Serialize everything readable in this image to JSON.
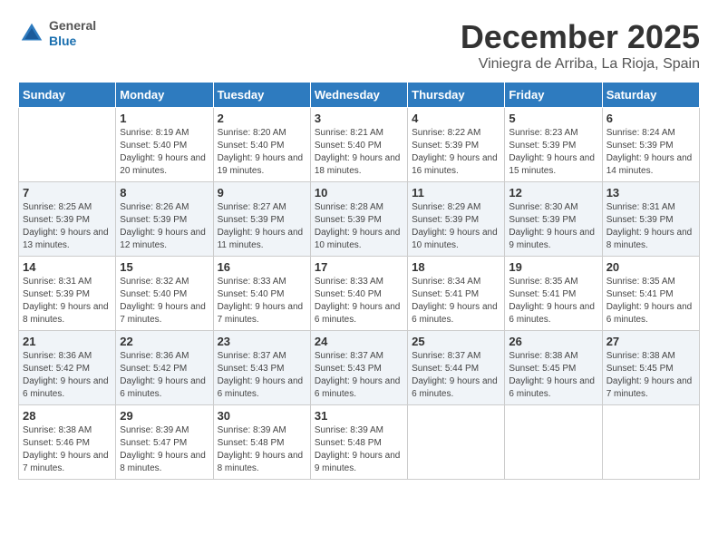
{
  "header": {
    "logo_general": "General",
    "logo_blue": "Blue",
    "month_title": "December 2025",
    "location": "Viniegra de Arriba, La Rioja, Spain"
  },
  "calendar": {
    "days_of_week": [
      "Sunday",
      "Monday",
      "Tuesday",
      "Wednesday",
      "Thursday",
      "Friday",
      "Saturday"
    ],
    "weeks": [
      [
        {
          "day": "",
          "sunrise": "",
          "sunset": "",
          "daylight": ""
        },
        {
          "day": "1",
          "sunrise": "Sunrise: 8:19 AM",
          "sunset": "Sunset: 5:40 PM",
          "daylight": "Daylight: 9 hours and 20 minutes."
        },
        {
          "day": "2",
          "sunrise": "Sunrise: 8:20 AM",
          "sunset": "Sunset: 5:40 PM",
          "daylight": "Daylight: 9 hours and 19 minutes."
        },
        {
          "day": "3",
          "sunrise": "Sunrise: 8:21 AM",
          "sunset": "Sunset: 5:40 PM",
          "daylight": "Daylight: 9 hours and 18 minutes."
        },
        {
          "day": "4",
          "sunrise": "Sunrise: 8:22 AM",
          "sunset": "Sunset: 5:39 PM",
          "daylight": "Daylight: 9 hours and 16 minutes."
        },
        {
          "day": "5",
          "sunrise": "Sunrise: 8:23 AM",
          "sunset": "Sunset: 5:39 PM",
          "daylight": "Daylight: 9 hours and 15 minutes."
        },
        {
          "day": "6",
          "sunrise": "Sunrise: 8:24 AM",
          "sunset": "Sunset: 5:39 PM",
          "daylight": "Daylight: 9 hours and 14 minutes."
        }
      ],
      [
        {
          "day": "7",
          "sunrise": "Sunrise: 8:25 AM",
          "sunset": "Sunset: 5:39 PM",
          "daylight": "Daylight: 9 hours and 13 minutes."
        },
        {
          "day": "8",
          "sunrise": "Sunrise: 8:26 AM",
          "sunset": "Sunset: 5:39 PM",
          "daylight": "Daylight: 9 hours and 12 minutes."
        },
        {
          "day": "9",
          "sunrise": "Sunrise: 8:27 AM",
          "sunset": "Sunset: 5:39 PM",
          "daylight": "Daylight: 9 hours and 11 minutes."
        },
        {
          "day": "10",
          "sunrise": "Sunrise: 8:28 AM",
          "sunset": "Sunset: 5:39 PM",
          "daylight": "Daylight: 9 hours and 10 minutes."
        },
        {
          "day": "11",
          "sunrise": "Sunrise: 8:29 AM",
          "sunset": "Sunset: 5:39 PM",
          "daylight": "Daylight: 9 hours and 10 minutes."
        },
        {
          "day": "12",
          "sunrise": "Sunrise: 8:30 AM",
          "sunset": "Sunset: 5:39 PM",
          "daylight": "Daylight: 9 hours and 9 minutes."
        },
        {
          "day": "13",
          "sunrise": "Sunrise: 8:31 AM",
          "sunset": "Sunset: 5:39 PM",
          "daylight": "Daylight: 9 hours and 8 minutes."
        }
      ],
      [
        {
          "day": "14",
          "sunrise": "Sunrise: 8:31 AM",
          "sunset": "Sunset: 5:39 PM",
          "daylight": "Daylight: 9 hours and 8 minutes."
        },
        {
          "day": "15",
          "sunrise": "Sunrise: 8:32 AM",
          "sunset": "Sunset: 5:40 PM",
          "daylight": "Daylight: 9 hours and 7 minutes."
        },
        {
          "day": "16",
          "sunrise": "Sunrise: 8:33 AM",
          "sunset": "Sunset: 5:40 PM",
          "daylight": "Daylight: 9 hours and 7 minutes."
        },
        {
          "day": "17",
          "sunrise": "Sunrise: 8:33 AM",
          "sunset": "Sunset: 5:40 PM",
          "daylight": "Daylight: 9 hours and 6 minutes."
        },
        {
          "day": "18",
          "sunrise": "Sunrise: 8:34 AM",
          "sunset": "Sunset: 5:41 PM",
          "daylight": "Daylight: 9 hours and 6 minutes."
        },
        {
          "day": "19",
          "sunrise": "Sunrise: 8:35 AM",
          "sunset": "Sunset: 5:41 PM",
          "daylight": "Daylight: 9 hours and 6 minutes."
        },
        {
          "day": "20",
          "sunrise": "Sunrise: 8:35 AM",
          "sunset": "Sunset: 5:41 PM",
          "daylight": "Daylight: 9 hours and 6 minutes."
        }
      ],
      [
        {
          "day": "21",
          "sunrise": "Sunrise: 8:36 AM",
          "sunset": "Sunset: 5:42 PM",
          "daylight": "Daylight: 9 hours and 6 minutes."
        },
        {
          "day": "22",
          "sunrise": "Sunrise: 8:36 AM",
          "sunset": "Sunset: 5:42 PM",
          "daylight": "Daylight: 9 hours and 6 minutes."
        },
        {
          "day": "23",
          "sunrise": "Sunrise: 8:37 AM",
          "sunset": "Sunset: 5:43 PM",
          "daylight": "Daylight: 9 hours and 6 minutes."
        },
        {
          "day": "24",
          "sunrise": "Sunrise: 8:37 AM",
          "sunset": "Sunset: 5:43 PM",
          "daylight": "Daylight: 9 hours and 6 minutes."
        },
        {
          "day": "25",
          "sunrise": "Sunrise: 8:37 AM",
          "sunset": "Sunset: 5:44 PM",
          "daylight": "Daylight: 9 hours and 6 minutes."
        },
        {
          "day": "26",
          "sunrise": "Sunrise: 8:38 AM",
          "sunset": "Sunset: 5:45 PM",
          "daylight": "Daylight: 9 hours and 6 minutes."
        },
        {
          "day": "27",
          "sunrise": "Sunrise: 8:38 AM",
          "sunset": "Sunset: 5:45 PM",
          "daylight": "Daylight: 9 hours and 7 minutes."
        }
      ],
      [
        {
          "day": "28",
          "sunrise": "Sunrise: 8:38 AM",
          "sunset": "Sunset: 5:46 PM",
          "daylight": "Daylight: 9 hours and 7 minutes."
        },
        {
          "day": "29",
          "sunrise": "Sunrise: 8:39 AM",
          "sunset": "Sunset: 5:47 PM",
          "daylight": "Daylight: 9 hours and 8 minutes."
        },
        {
          "day": "30",
          "sunrise": "Sunrise: 8:39 AM",
          "sunset": "Sunset: 5:48 PM",
          "daylight": "Daylight: 9 hours and 8 minutes."
        },
        {
          "day": "31",
          "sunrise": "Sunrise: 8:39 AM",
          "sunset": "Sunset: 5:48 PM",
          "daylight": "Daylight: 9 hours and 9 minutes."
        },
        {
          "day": "",
          "sunrise": "",
          "sunset": "",
          "daylight": ""
        },
        {
          "day": "",
          "sunrise": "",
          "sunset": "",
          "daylight": ""
        },
        {
          "day": "",
          "sunrise": "",
          "sunset": "",
          "daylight": ""
        }
      ]
    ]
  }
}
